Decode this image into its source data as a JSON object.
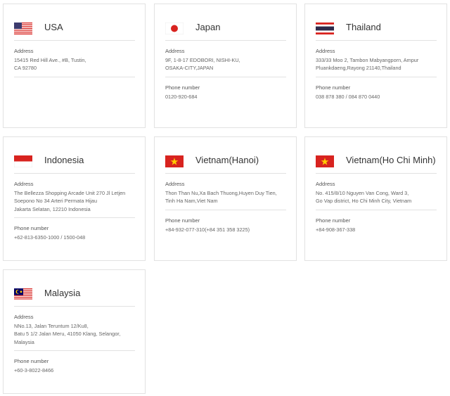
{
  "labels": {
    "address": "Address",
    "phone": "Phone number"
  },
  "offices": [
    {
      "country": "USA",
      "flag": "usa-flag",
      "address": [
        "15415 Red Hill Ave., #B, Tustin,",
        "CA 92780"
      ],
      "phone": ""
    },
    {
      "country": "Japan",
      "flag": "japan-flag",
      "address": [
        "9F, 1-8-17 EDOBORI, NISHI-KU,",
        "OSAKA-CITY,JAPAN"
      ],
      "phone": "0120-920-684"
    },
    {
      "country": "Thailand",
      "flag": "thailand-flag",
      "address": [
        "333/33 Moo 2, Tambon Mabyangporn, Ampur",
        "Pluankdaeng,Rayong 21140,Thailand"
      ],
      "phone": "038 878 380 / 084 870 0440"
    },
    {
      "country": "Indonesia",
      "flag": "indonesia-flag",
      "address": [
        "The Bellezza Shopping Arcade Unit 270 Jl Letjen",
        "Soepono No 34 Arteri Permata Hijau",
        "Jakarta Selatan, 12210 Indonesia"
      ],
      "phone": "+62-813-6350-1000 / 1500-048"
    },
    {
      "country": "Vietnam(Hanoi)",
      "flag": "vietnam-flag",
      "address": [
        "Thon Than Nu,Xa Bach Thuong,Huyen Duy Tien,",
        "Tinh Ha Nam,Viet Nam"
      ],
      "phone": "+84-932-077-310(+84 351 358 3225)"
    },
    {
      "country": "Vietnam(Ho Chi Minh)",
      "flag": "vietnam-flag",
      "address": [
        "No. 415/8/10 Nguyen Van Cong, Ward 3,",
        "Go Vap district, Ho Chi Minh City, Vietnam"
      ],
      "phone": "+84-908-367-338"
    },
    {
      "country": "Malaysia",
      "flag": "malaysia-flag",
      "address": [
        "NNo.13, Jalan Teruntum 12/Ku8,",
        "Batu 5 1/2 Jalan Meru, 41050 Klang, Selangor,",
        "Malaysia"
      ],
      "phone": "+60-3-8022-8466"
    }
  ],
  "colors": {
    "border": "#e2e2e2",
    "red": "#d8231f",
    "blue_us": "#3c3b6e",
    "blue_th": "#2d2a4a",
    "blue_my": "#010066",
    "yellow": "#ffcc00"
  }
}
